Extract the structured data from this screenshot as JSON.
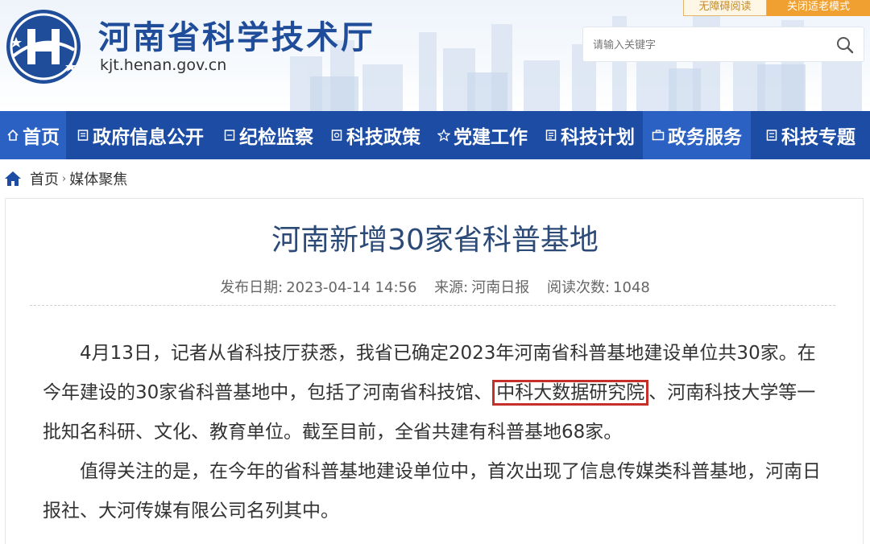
{
  "header": {
    "site_title": "河南省科学技术厅",
    "site_domain": "kjt.henan.gov.cn",
    "btn_accessible": "无障碍阅读",
    "btn_elderly": "关闭适老模式",
    "search_placeholder": "请输入关键字",
    "accent_color": "#1c4ca3"
  },
  "nav": {
    "items": [
      {
        "label": "首页",
        "icon": "home-icon",
        "active": true
      },
      {
        "label": "政府信息公开",
        "icon": "document-icon",
        "active": false
      },
      {
        "label": "纪检监察",
        "icon": "document-icon",
        "active": false
      },
      {
        "label": "科技政策",
        "icon": "document-icon",
        "active": false
      },
      {
        "label": "党建工作",
        "icon": "star-icon",
        "active": false
      },
      {
        "label": "科技计划",
        "icon": "document-icon",
        "active": false
      },
      {
        "label": "政务服务",
        "icon": "briefcase-icon",
        "active": true
      },
      {
        "label": "科技专题",
        "icon": "document-icon",
        "active": false
      }
    ]
  },
  "breadcrumb": {
    "home": "首页",
    "separator": "›",
    "current": "媒体聚焦"
  },
  "article": {
    "title": "河南新增30家省科普基地",
    "publish_date_label": "发布日期:",
    "publish_date": "2023-04-14 14:56",
    "source_label": "来源:",
    "source": "河南日报",
    "views_label": "阅读次数:",
    "views": "1048",
    "p1_before": "4月13日，记者从省科技厅获悉，我省已确定2023年河南省科普基地建设单位共30家。在今年建设的30家省科普基地中，包括了河南省科技馆、",
    "p1_highlight": "中科大数据研究院",
    "p1_after": "、河南科技大学等一批知名科研、文化、教育单位。截至目前，全省共建有科普基地68家。",
    "p2": "值得关注的是，在今年的省科普基地建设单位中，首次出现了信息传媒类科普基地，河南日报社、大河传媒有限公司名列其中。",
    "highlight_color": "#c6302b"
  }
}
